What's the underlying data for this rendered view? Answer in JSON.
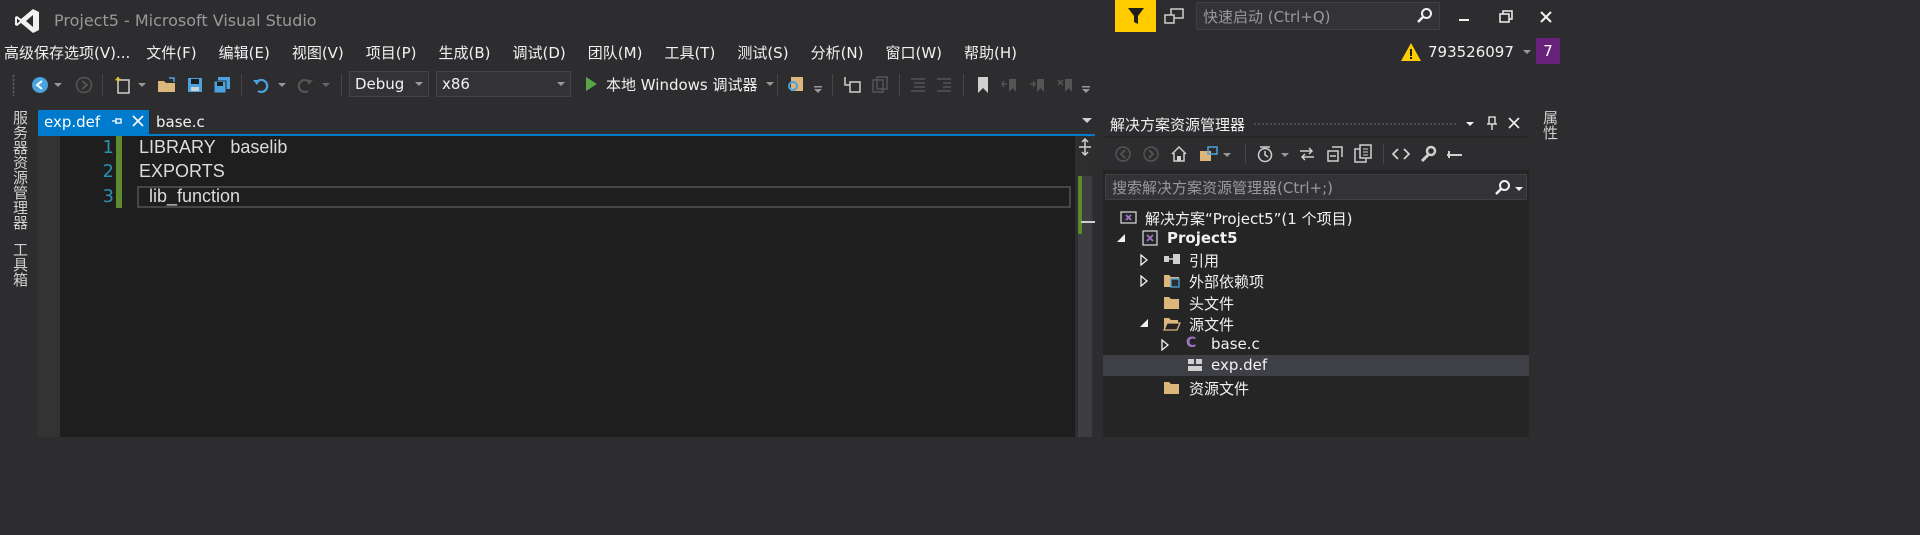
{
  "window": {
    "title": "Project5 - Microsoft Visual Studio",
    "quick_launch_placeholder": "快速启动 (Ctrl+Q)"
  },
  "menu": [
    "高级保存选项(V)...",
    "文件(F)",
    "编辑(E)",
    "视图(V)",
    "项目(P)",
    "生成(B)",
    "调试(D)",
    "团队(M)",
    "工具(T)",
    "测试(S)",
    "分析(N)",
    "窗口(W)",
    "帮助(H)"
  ],
  "account": {
    "name": "793526097",
    "avatar_text": "7"
  },
  "toolbar": {
    "config": "Debug",
    "platform": "x86",
    "run_label": "本地 Windows 调试器"
  },
  "side_tabs": {
    "left": [
      "服务器资源管理器",
      "工具箱"
    ],
    "right": [
      "属性"
    ]
  },
  "editor": {
    "tabs": [
      "exp.def",
      "base.c"
    ],
    "line_numbers": [
      "1",
      "2",
      "3"
    ],
    "lines": [
      "LIBRARY   baselib",
      "EXPORTS",
      "  lib_function"
    ]
  },
  "solution_explorer": {
    "title": "解决方案资源管理器",
    "search_placeholder": "搜索解决方案资源管理器(Ctrl+;)",
    "tree": [
      "解决方案“Project5”(1 个项目)",
      "Project5",
      "引用",
      "外部依赖项",
      "头文件",
      "源文件",
      "base.c",
      "exp.def",
      "资源文件"
    ]
  },
  "colors": {
    "accent": "#007acc",
    "background": "#2d2d30",
    "editor_bg": "#1e1e1e",
    "line_number": "#2b91af",
    "filter_button": "#ffcc00",
    "avatar": "#68217a"
  }
}
